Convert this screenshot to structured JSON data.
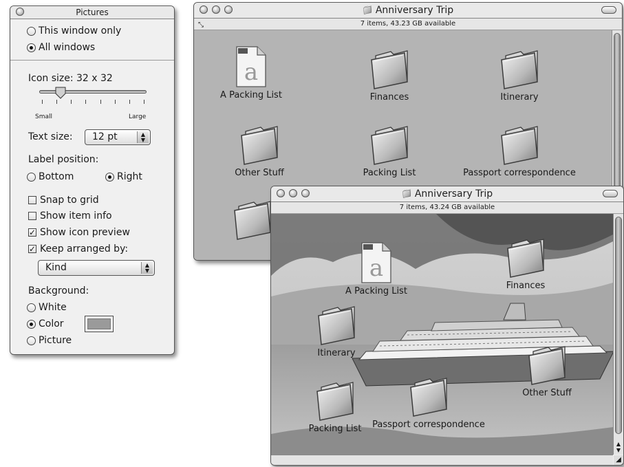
{
  "panel": {
    "title": "Pictures",
    "scope_this_window": "This window only",
    "scope_all_windows": "All windows",
    "icon_size_label": "Icon size: 32 x 32",
    "slider_min": "Small",
    "slider_max": "Large",
    "icon_size_fraction": 0.18,
    "text_size_label": "Text size:",
    "text_size_value": "12 pt",
    "label_position_label": "Label position:",
    "label_bottom": "Bottom",
    "label_right": "Right",
    "snap_to_grid": "Snap to grid",
    "show_item_info": "Show item info",
    "show_icon_preview": "Show icon preview",
    "keep_arranged_by": "Keep arranged by:",
    "arrange_value": "Kind",
    "background_label": "Background:",
    "bg_white": "White",
    "bg_color": "Color",
    "bg_picture": "Picture",
    "color_swatch": "#9a9a9a"
  },
  "window_back": {
    "title": "Anniversary Trip",
    "status": "7 items, 43.23 GB available",
    "items": [
      "A Packing List",
      "Finances",
      "Itinerary",
      "Other Stuff",
      "Packing List",
      "Passport correspondence"
    ]
  },
  "window_front": {
    "title": "Anniversary Trip",
    "status": "7 items, 43.24 GB available",
    "items": [
      "A Packing List",
      "Finances",
      "Itinerary",
      "Other Stuff",
      "Packing List",
      "Passport correspondence"
    ]
  },
  "icons": {
    "document": "text-document-icon",
    "folder": "folder-icon"
  }
}
